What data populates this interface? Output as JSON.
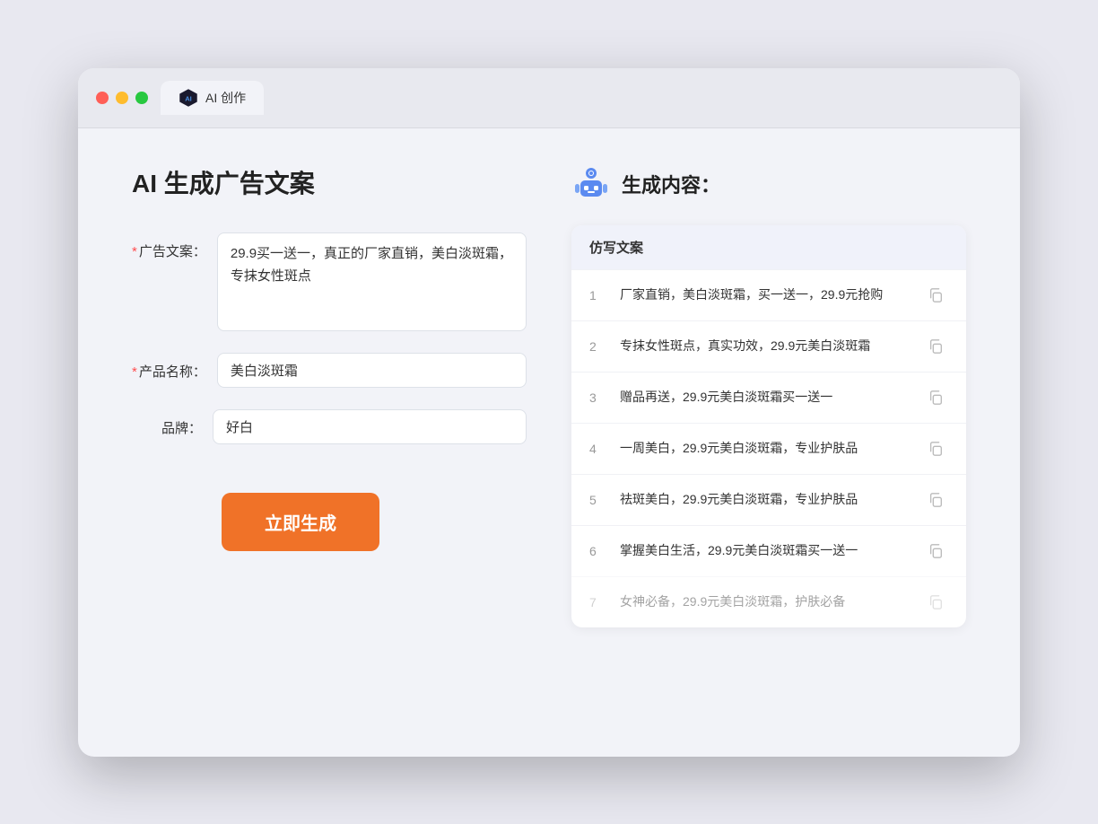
{
  "window": {
    "tab_label": "AI 创作"
  },
  "left_panel": {
    "title": "AI 生成广告文案",
    "fields": [
      {
        "label": "广告文案：",
        "required": true,
        "type": "textarea",
        "value": "29.9买一送一，真正的厂家直销，美白淡斑霜，专抹女性斑点",
        "name": "ad-copy-field"
      },
      {
        "label": "产品名称：",
        "required": true,
        "type": "input",
        "value": "美白淡斑霜",
        "name": "product-name-field"
      },
      {
        "label": "品牌：",
        "required": false,
        "type": "input",
        "value": "好白",
        "name": "brand-field"
      }
    ],
    "button_label": "立即生成"
  },
  "right_panel": {
    "title": "生成内容：",
    "column_header": "仿写文案",
    "results": [
      {
        "num": "1",
        "text": "厂家直销，美白淡斑霜，买一送一，29.9元抢购"
      },
      {
        "num": "2",
        "text": "专抹女性斑点，真实功效，29.9元美白淡斑霜"
      },
      {
        "num": "3",
        "text": "赠品再送，29.9元美白淡斑霜买一送一"
      },
      {
        "num": "4",
        "text": "一周美白，29.9元美白淡斑霜，专业护肤品"
      },
      {
        "num": "5",
        "text": "祛斑美白，29.9元美白淡斑霜，专业护肤品"
      },
      {
        "num": "6",
        "text": "掌握美白生活，29.9元美白淡斑霜买一送一"
      },
      {
        "num": "7",
        "text": "女神必备，29.9元美白淡斑霜，护肤必备"
      }
    ]
  }
}
